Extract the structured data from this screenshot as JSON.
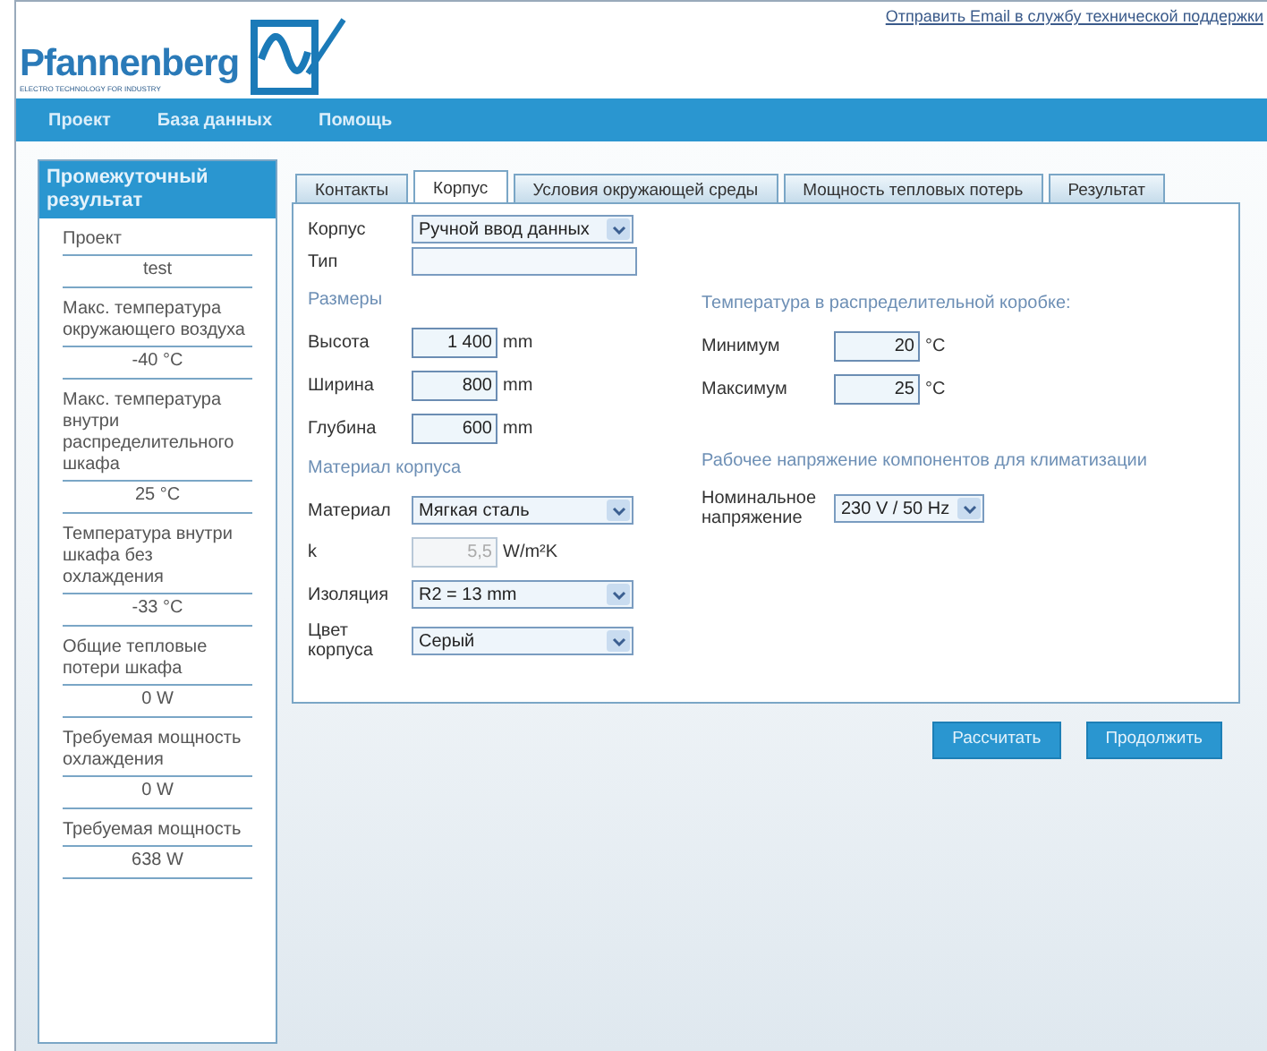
{
  "header": {
    "logo_text": "Pfannenberg",
    "logo_tagline": "ELECTRO TECHNOLOGY FOR INDUSTRY",
    "support_link": "Отправить Email в службу технической поддержки"
  },
  "menu": [
    "Проект",
    "База данных",
    "Помощь"
  ],
  "sidebar": {
    "title": "Промежуточный результат",
    "rows": [
      {
        "kind": "heading",
        "text": "Проект"
      },
      {
        "kind": "result",
        "text": "test"
      },
      {
        "kind": "heading",
        "text": "Макс. температура окружающего воздуха"
      },
      {
        "kind": "result",
        "text": "-40 °C"
      },
      {
        "kind": "heading",
        "text": "Макс. температура внутри распределительного шкафа"
      },
      {
        "kind": "result",
        "text": "25 °C"
      },
      {
        "kind": "heading",
        "text": "Температура внутри шкафа без охлаждения"
      },
      {
        "kind": "result",
        "text": "-33 °C"
      },
      {
        "kind": "heading",
        "text": "Общие тепловые потери шкафа"
      },
      {
        "kind": "result",
        "text": "0 W"
      },
      {
        "kind": "heading",
        "text": "Требуемая мощность охлаждения"
      },
      {
        "kind": "result",
        "text": "0 W"
      },
      {
        "kind": "heading",
        "text": "Требуемая мощность"
      },
      {
        "kind": "result",
        "text": "638 W"
      }
    ]
  },
  "tabs": [
    {
      "label": "Контакты",
      "selected": false
    },
    {
      "label": "Корпус",
      "selected": true
    },
    {
      "label": "Условия окружающей среды",
      "selected": false
    },
    {
      "label": "Мощность тепловых потерь",
      "selected": false
    },
    {
      "label": "Результат",
      "selected": false
    }
  ],
  "form": {
    "top": [
      {
        "kind": "select",
        "label": "Корпус",
        "value": "Ручной ввод данных"
      },
      {
        "kind": "input",
        "label": "Тип"
      }
    ],
    "left_sections": [
      {
        "title": "Размеры",
        "fields": [
          {
            "kind": "input",
            "label": "Высота",
            "value": "1 400",
            "unit": "mm",
            "disabled": false
          },
          {
            "kind": "input",
            "label": "Ширина",
            "value": "800",
            "unit": "mm",
            "disabled": false
          },
          {
            "kind": "input",
            "label": "Глубина",
            "value": "600",
            "unit": "mm",
            "disabled": false
          }
        ]
      },
      {
        "title": "Материал корпуса",
        "fields": [
          {
            "kind": "select",
            "label": "Материал",
            "value": "Мягкая сталь"
          },
          {
            "kind": "input",
            "label": "k",
            "value": "5,5",
            "unit": "W/m²K",
            "disabled": true
          },
          {
            "kind": "select",
            "label": "Изоляция",
            "value": "R2 = 13 mm"
          },
          {
            "kind": "select",
            "label": "Цвет корпуса",
            "value": "Серый"
          }
        ]
      }
    ],
    "right_sections": [
      {
        "title": "Температура в распределительной коробке:",
        "fields": [
          {
            "kind": "input",
            "label": "Минимум",
            "value": "20",
            "unit": "°C",
            "disabled": false
          },
          {
            "kind": "input",
            "label": "Максимум",
            "value": "25",
            "unit": "°C",
            "disabled": false
          }
        ]
      },
      {
        "title": "Рабочее напряжение компонентов для климатизации",
        "fields": [
          {
            "kind": "select",
            "label": "Номинальное напряжение",
            "value": "230 V / 50 Hz"
          }
        ]
      }
    ]
  },
  "buttons": [
    "Рассчитать",
    "Продолжить"
  ]
}
